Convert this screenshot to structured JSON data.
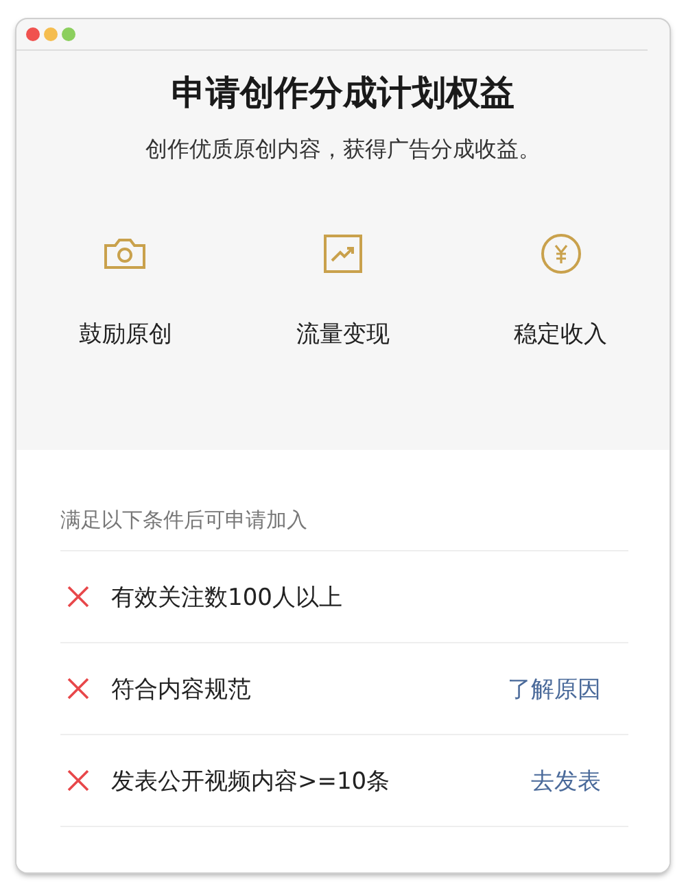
{
  "title": "申请创作分成计划权益",
  "subtitle": "创作优质原创内容，获得广告分成收益。",
  "benefits": [
    {
      "kind": "camera",
      "label": "鼓励原创"
    },
    {
      "kind": "chart",
      "label": "流量变现"
    },
    {
      "kind": "yen",
      "label": "稳定收入"
    }
  ],
  "conditions_heading": "满足以下条件后可申请加入",
  "conditions": [
    {
      "text": "有效关注数100人以上",
      "met": false
    },
    {
      "text": "符合内容规范",
      "met": false,
      "action": "了解原因"
    },
    {
      "text": "发表公开视频内容>=10条",
      "met": false,
      "action": "去发表"
    }
  ]
}
